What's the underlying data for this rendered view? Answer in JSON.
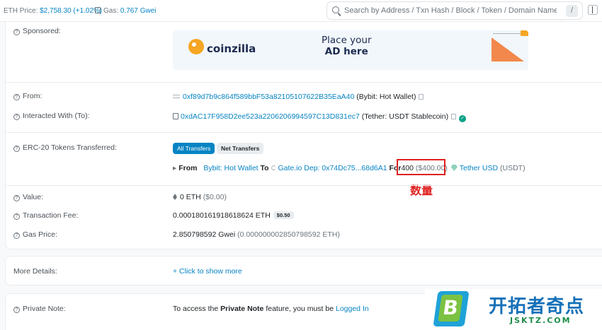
{
  "topbar": {
    "eth_price_label": "ETH Price:",
    "eth_price_value": "$2,758.30 (+1.02%)",
    "gas_label": "Gas:",
    "gas_value": "0.767 Gwei",
    "search_placeholder": "Search by Address / Txn Hash / Block / Token / Domain Name",
    "search_shortcut": "/"
  },
  "sponsored": {
    "label": "Sponsored:",
    "brand": "coinzilla",
    "cta_line1": "Place your",
    "cta_line2": "AD here"
  },
  "from": {
    "label": "From:",
    "address": "0xf89d7b9c864f589bbF53a82105107622B35EaA40",
    "tag": "(Bybit: Hot Wallet)"
  },
  "interacted": {
    "label": "Interacted With (To):",
    "address": "0xdAC17F958D2ee523a2206206994597C13D831ec7",
    "tag": "(Tether: USDT Stablecoin)"
  },
  "tokens": {
    "label": "ERC-20 Tokens Transferred:",
    "tab_all": "All Transfers",
    "tab_net": "Net Transfers",
    "from_word": "From",
    "from_name": "Bybit: Hot Wallet",
    "to_word": "To",
    "to_name": "Gate.io Dep: 0x74Dc75...68d6A1",
    "for_word": "For",
    "amount": "400",
    "amount_usd": "($400.00)",
    "token_name": "Tether USD",
    "token_symbol": "(USDT)"
  },
  "annotation": {
    "label": "数量",
    "color": "#e02020"
  },
  "value": {
    "label": "Value:",
    "amount": "0 ETH",
    "usd": "($0.00)"
  },
  "fee": {
    "label": "Transaction Fee:",
    "amount": "0.000180161918618624 ETH",
    "badge": "$0.50"
  },
  "gas_price": {
    "label": "Gas Price:",
    "amount": "2.850798592 Gwei",
    "eth": "(0.000000002850798592 ETH)"
  },
  "more_details": {
    "label": "More Details:",
    "link": "+ Click to show more"
  },
  "private_note": {
    "label": "Private Note:",
    "text_before": "To access the",
    "bold": "Private Note",
    "text_after": "feature, you must be",
    "link": "Logged In"
  },
  "watermark": {
    "logo_letter": "B",
    "cn": "开拓者奇点",
    "en": "JSKTZ.COM"
  },
  "colors": {
    "link": "#0784c3",
    "accent": "#0784c3",
    "check": "#00a186"
  }
}
